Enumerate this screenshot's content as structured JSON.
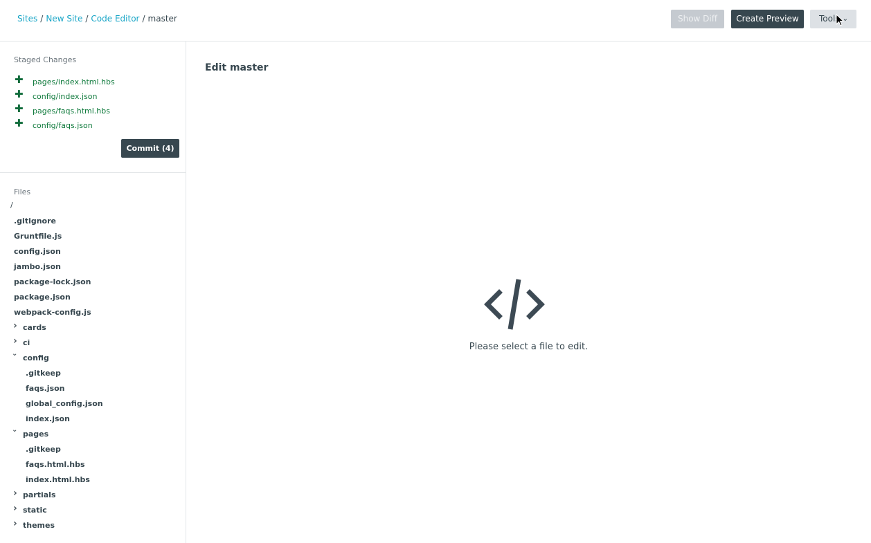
{
  "breadcrumb": {
    "items": [
      "Sites",
      "New Site",
      "Code Editor"
    ],
    "separator": "/",
    "current": "master"
  },
  "toolbar": {
    "show_diff_label": "Show Diff",
    "create_preview_label": "Create Preview",
    "tools_label": "Tools"
  },
  "staged": {
    "title": "Staged Changes",
    "items": [
      {
        "icon": "plus-icon",
        "name": "pages/index.html.hbs"
      },
      {
        "icon": "plus-icon",
        "name": "config/index.json"
      },
      {
        "icon": "plus-icon",
        "name": "pages/faqs.html.hbs"
      },
      {
        "icon": "plus-icon",
        "name": "config/faqs.json"
      }
    ],
    "commit_label": "Commit (4)"
  },
  "files": {
    "title": "Files",
    "root": "/",
    "tree": [
      {
        "name": ".gitignore",
        "type": "file",
        "depth": 0
      },
      {
        "name": "Gruntfile.js",
        "type": "file",
        "depth": 0
      },
      {
        "name": "config.json",
        "type": "file",
        "depth": 0
      },
      {
        "name": "jambo.json",
        "type": "file",
        "depth": 0
      },
      {
        "name": "package-lock.json",
        "type": "file",
        "depth": 0
      },
      {
        "name": "package.json",
        "type": "file",
        "depth": 0
      },
      {
        "name": "webpack-config.js",
        "type": "file",
        "depth": 0
      },
      {
        "name": "cards",
        "type": "folder",
        "expanded": false,
        "depth": 0
      },
      {
        "name": "ci",
        "type": "folder",
        "expanded": false,
        "depth": 0
      },
      {
        "name": "config",
        "type": "folder",
        "expanded": true,
        "depth": 0
      },
      {
        "name": ".gitkeep",
        "type": "file",
        "depth": 1
      },
      {
        "name": "faqs.json",
        "type": "file",
        "depth": 1
      },
      {
        "name": "global_config.json",
        "type": "file",
        "depth": 1
      },
      {
        "name": "index.json",
        "type": "file",
        "depth": 1
      },
      {
        "name": "pages",
        "type": "folder",
        "expanded": true,
        "depth": 0
      },
      {
        "name": ".gitkeep",
        "type": "file",
        "depth": 1
      },
      {
        "name": "faqs.html.hbs",
        "type": "file",
        "depth": 1
      },
      {
        "name": "index.html.hbs",
        "type": "file",
        "depth": 1
      },
      {
        "name": "partials",
        "type": "folder",
        "expanded": false,
        "depth": 0
      },
      {
        "name": "static",
        "type": "folder",
        "expanded": false,
        "depth": 0
      },
      {
        "name": "themes",
        "type": "folder",
        "expanded": false,
        "depth": 0
      }
    ]
  },
  "main": {
    "title": "Edit master",
    "empty_icon": "code-icon",
    "empty_message": "Please select a file to edit."
  },
  "colors": {
    "accent": "#1aa6c7",
    "primary_button": "#37474f",
    "staged_green": "#0f7a3c"
  }
}
